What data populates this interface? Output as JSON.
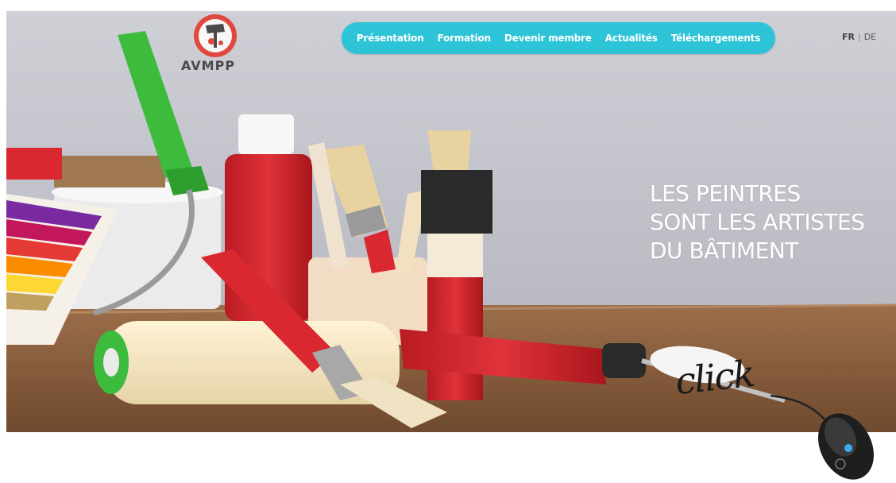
{
  "brand": {
    "logo_text": "AVMPP",
    "logo_icon": "paint-roller-logo-icon"
  },
  "nav": {
    "items": [
      {
        "label": "Présentation"
      },
      {
        "label": "Formation"
      },
      {
        "label": "Devenir membre"
      },
      {
        "label": "Actualités"
      },
      {
        "label": "Téléchargements"
      }
    ],
    "background_color": "#2ec4d8"
  },
  "language": {
    "active": "FR",
    "separator": "|",
    "other": "DE"
  },
  "hero": {
    "headline_lines": [
      "LES PEINTRES",
      "SONT LES ARTISTES",
      "DU BÂTIMENT"
    ],
    "image_subject": "painting tools",
    "overlay_text": "click",
    "overlay_icon": "computer-mouse-icon"
  },
  "colors": {
    "accent": "#2ec4d8",
    "brand_red": "#d9282f",
    "headline": "#ffffff"
  }
}
